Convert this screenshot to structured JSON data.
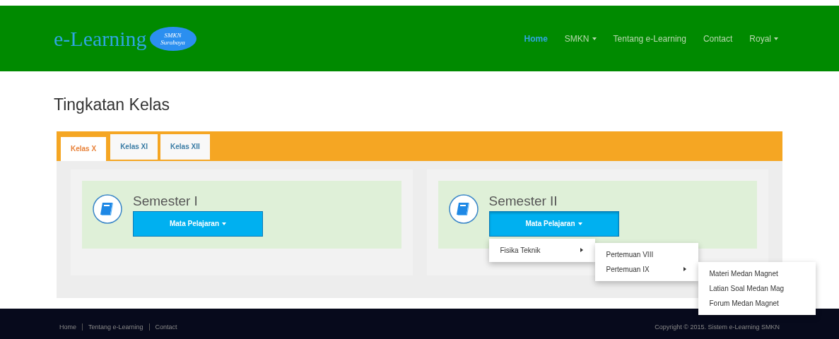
{
  "brand": {
    "title": "e-Learning",
    "badge_line_1": "SMKN",
    "badge_line_2": "Surabaya"
  },
  "nav": [
    {
      "label": "Home",
      "selected": true,
      "dropdown": false
    },
    {
      "label": "SMKN",
      "selected": false,
      "dropdown": true
    },
    {
      "label": "Tentang e-Learning",
      "selected": false,
      "dropdown": false
    },
    {
      "label": "Contact",
      "selected": false,
      "dropdown": false
    },
    {
      "label": "Royal",
      "selected": false,
      "dropdown": true
    }
  ],
  "heading": "Tingkatan Kelas",
  "tabs": [
    {
      "label": "Kelas X",
      "selected": true
    },
    {
      "label": "Kelas XI",
      "selected": false
    },
    {
      "label": "Kelas XII",
      "selected": false
    }
  ],
  "semesters": [
    {
      "title": "Semester I",
      "button": "Mata Pelajaran",
      "expanded": false
    },
    {
      "title": "Semester II",
      "button": "Mata Pelajaran",
      "expanded": true,
      "menu": [
        {
          "label": "Fisika Teknik",
          "children": [
            {
              "label": "Pertemuan VIII"
            },
            {
              "label": "Pertemuan IX",
              "children": [
                {
                  "label": "Materi Medan Magnet"
                },
                {
                  "label": "Latian Soal Medan Mag"
                },
                {
                  "label": "Forum Medan Magnet"
                }
              ]
            }
          ]
        }
      ]
    }
  ],
  "footer": {
    "links": [
      "Home",
      "Tentang e-Learning",
      "Contact"
    ],
    "copyright": "Copyright © 2015. Sistem e-Learning SMKN"
  }
}
